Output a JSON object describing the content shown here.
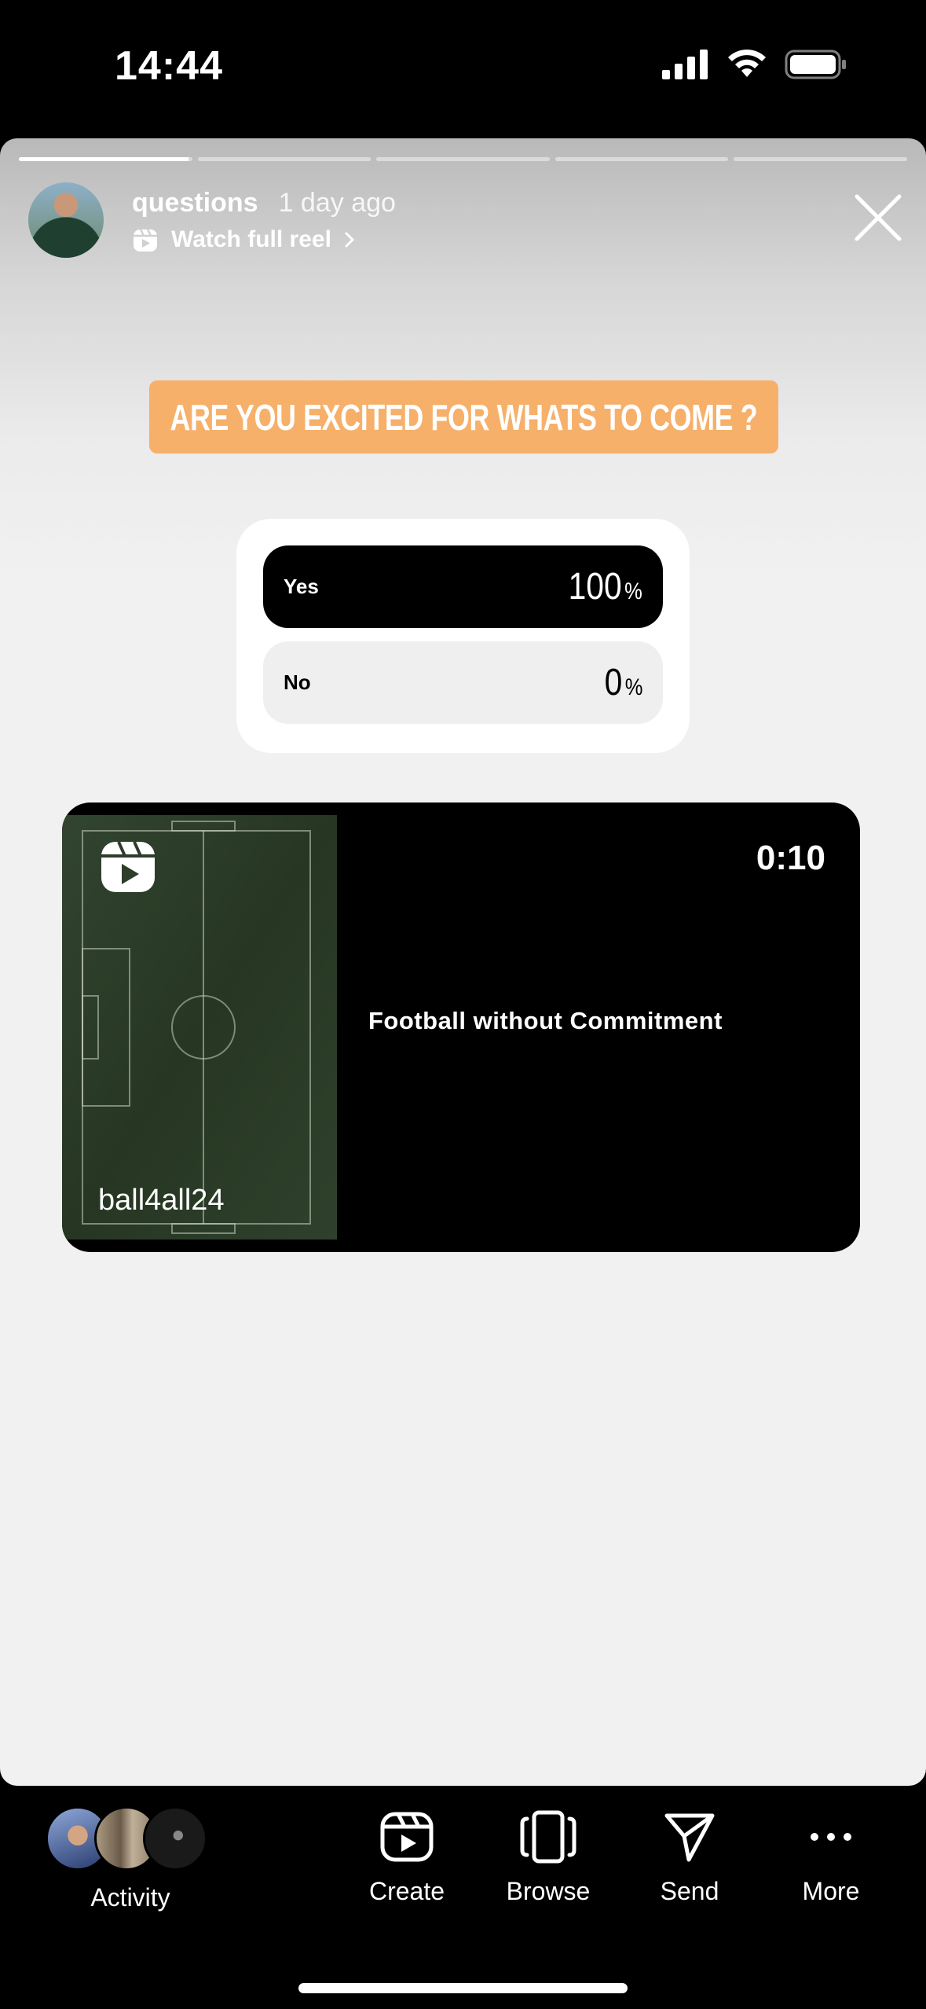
{
  "status_bar": {
    "time": "14:44"
  },
  "story": {
    "progress": {
      "segments": 5,
      "current_index": 0,
      "current_fraction": 0.98
    },
    "username": "questions",
    "time_ago": "1 day ago",
    "reel_link": "Watch full reel",
    "question": "ARE YOU EXCITED FOR WHATS TO COME ?",
    "poll": {
      "options": [
        {
          "label": "Yes",
          "percent": "100",
          "fraction": 1.0
        },
        {
          "label": "No",
          "percent": "0",
          "fraction": 0.0
        }
      ],
      "percent_sign": "%"
    },
    "reel": {
      "duration": "0:10",
      "caption": "Football without Commitment",
      "username": "ball4all24"
    }
  },
  "bottom_nav": {
    "activity_label": "Activity",
    "items": [
      {
        "label": "Create",
        "icon": "reels-icon"
      },
      {
        "label": "Browse",
        "icon": "browse-icon"
      },
      {
        "label": "Send",
        "icon": "send-icon"
      },
      {
        "label": "More",
        "icon": "more-icon"
      }
    ]
  },
  "colors": {
    "sticker": "#f6b06a",
    "story_bg": "#f1f1f1",
    "bars": "#000000"
  }
}
